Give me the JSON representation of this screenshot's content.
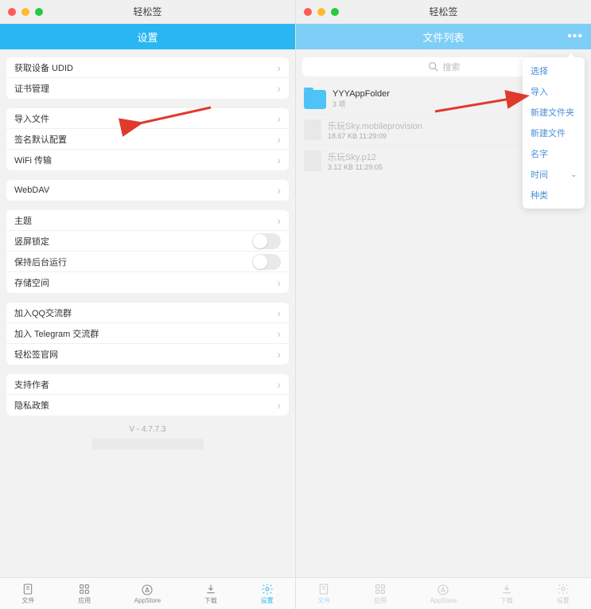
{
  "left": {
    "window_title": "轻松签",
    "nav_title": "设置",
    "groups": [
      {
        "rows": [
          {
            "label": "获取设备 UDID",
            "chev": true
          },
          {
            "label": "证书管理",
            "chev": true
          }
        ]
      },
      {
        "rows": [
          {
            "label": "导入文件",
            "chev": true
          },
          {
            "label": "签名默认配置",
            "chev": true
          },
          {
            "label": "WiFi 传输",
            "chev": true
          }
        ]
      },
      {
        "rows": [
          {
            "label": "WebDAV",
            "chev": true
          }
        ]
      },
      {
        "rows": [
          {
            "label": "主题",
            "chev": true
          },
          {
            "label": "竖屏锁定",
            "toggle": true
          },
          {
            "label": "保持后台运行",
            "toggle": true
          },
          {
            "label": "存储空间",
            "chev": true
          }
        ]
      },
      {
        "rows": [
          {
            "label": "加入QQ交流群",
            "chev": true
          },
          {
            "label": "加入 Telegram 交流群",
            "chev": true
          },
          {
            "label": "轻松签官网",
            "chev": true
          }
        ]
      },
      {
        "rows": [
          {
            "label": "支持作者",
            "chev": true
          },
          {
            "label": "隐私政策",
            "chev": true
          }
        ]
      }
    ],
    "version": "V - 4.7.7.3"
  },
  "right": {
    "window_title": "轻松签",
    "nav_title": "文件列表",
    "search_placeholder": "搜索",
    "files": [
      {
        "name": "YYYAppFolder",
        "sub": "3 项",
        "type": "folder"
      },
      {
        "name": "乐玩Sky.mobileprovision",
        "sub": "18.67 KB    11:29:09",
        "type": "doc",
        "faded": true
      },
      {
        "name": "乐玩Sky.p12",
        "sub": "3.12 KB    11:29:05",
        "type": "doc",
        "faded": true
      }
    ],
    "menu": [
      {
        "label": "选择"
      },
      {
        "label": "导入"
      },
      {
        "label": "新建文件夹"
      },
      {
        "label": "新建文件"
      },
      {
        "label": "名字"
      },
      {
        "label": "时间",
        "sub": true
      },
      {
        "label": "种类"
      }
    ]
  },
  "tabs": [
    {
      "label": "文件",
      "icon": "file"
    },
    {
      "label": "应用",
      "icon": "grid"
    },
    {
      "label": "AppStore",
      "icon": "appstore"
    },
    {
      "label": "下载",
      "icon": "download"
    },
    {
      "label": "设置",
      "icon": "gear"
    }
  ]
}
